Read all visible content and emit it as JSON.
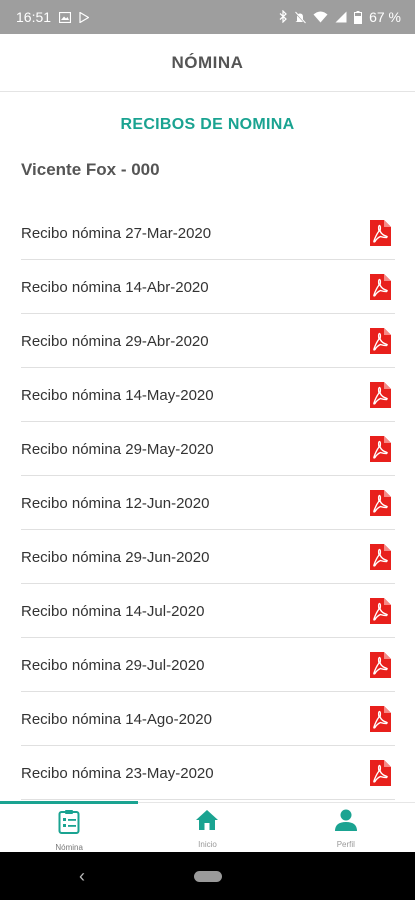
{
  "status_bar": {
    "time": "16:51",
    "battery": "67 %"
  },
  "app_bar": {
    "title": "NÓMINA"
  },
  "section_title": "RECIBOS DE NOMINA",
  "employee": "Vicente Fox - 000",
  "receipts": [
    {
      "label": "Recibo nómina 27-Mar-2020",
      "icon": "pdf-icon"
    },
    {
      "label": "Recibo nómina 14-Abr-2020",
      "icon": "pdf-icon"
    },
    {
      "label": "Recibo nómina 29-Abr-2020",
      "icon": "pdf-icon"
    },
    {
      "label": "Recibo nómina 14-May-2020",
      "icon": "pdf-icon"
    },
    {
      "label": "Recibo nómina 29-May-2020",
      "icon": "pdf-icon"
    },
    {
      "label": "Recibo nómina 12-Jun-2020",
      "icon": "pdf-icon"
    },
    {
      "label": "Recibo nómina 29-Jun-2020",
      "icon": "pdf-icon"
    },
    {
      "label": "Recibo nómina 14-Jul-2020",
      "icon": "pdf-icon"
    },
    {
      "label": "Recibo nómina 29-Jul-2020",
      "icon": "pdf-icon"
    },
    {
      "label": "Recibo nómina 14-Ago-2020",
      "icon": "pdf-icon"
    },
    {
      "label": "Recibo nómina 23-May-2020",
      "icon": "pdf-icon"
    }
  ],
  "bottom_nav": {
    "items": [
      {
        "label": "Nómina",
        "icon": "payroll-icon",
        "active": true
      },
      {
        "label": "Inicio",
        "icon": "home-icon",
        "active": false
      },
      {
        "label": "Perfil",
        "icon": "person-icon",
        "active": false
      }
    ]
  },
  "colors": {
    "accent": "#1aa391",
    "pdf_red": "#e8201c",
    "status_bar": "#9e9e9e"
  }
}
